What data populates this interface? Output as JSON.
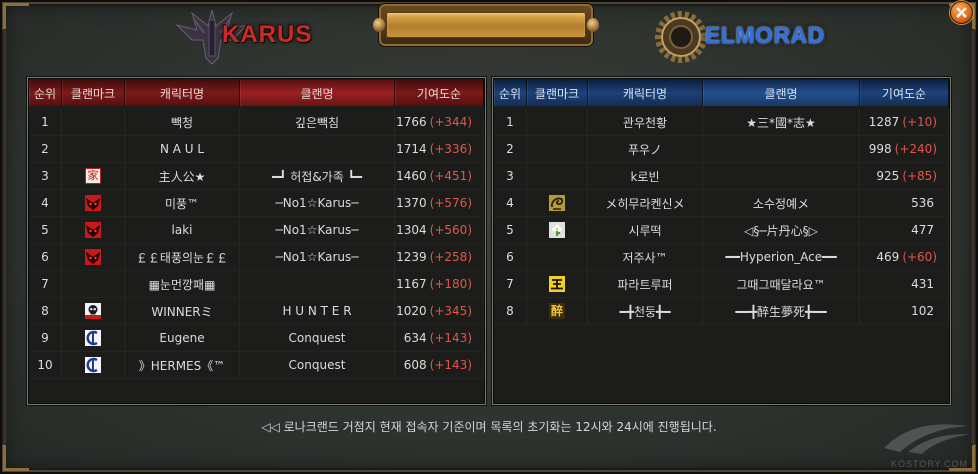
{
  "header": {
    "karus_title": "KARUS",
    "elmorad_title": "ELMORAD"
  },
  "icons": {
    "close": "close-icon",
    "karus_emblem": "karus-emblem-icon",
    "elmorad_emblem": "elmorad-emblem-icon"
  },
  "colors": {
    "karus_header": "#7c1a1a",
    "elmorad_header": "#1d4278",
    "karus_title": "#c62c28",
    "elmorad_title": "#2f70da",
    "delta": "#e0564a",
    "text": "#dcdcdc",
    "banner": "#c8923a",
    "close_button": "#e26c1a"
  },
  "karus": {
    "columns": [
      "순위",
      "클랜마크",
      "캐릭터명",
      "클랜명",
      "기여도순"
    ],
    "rows": [
      {
        "rank": "1",
        "name": "빽청",
        "clan": "깊은빽침",
        "score": "1766",
        "delta": "(+344)"
      },
      {
        "rank": "2",
        "name": "N A U L",
        "clan": "",
        "score": "1714",
        "delta": "(+336)"
      },
      {
        "rank": "3",
        "mark": {
          "icon": "clan-mark-house-icon",
          "glyph": "家"
        },
        "name": "主人公★",
        "clan": "━┛ 허접&가족 ┗━",
        "score": "1460",
        "delta": "(+451)"
      },
      {
        "rank": "4",
        "mark": {
          "icon": "clan-mark-red-mask-icon"
        },
        "name": "미풍™",
        "clan": "─No1☆Karus─",
        "score": "1370",
        "delta": "(+576)"
      },
      {
        "rank": "5",
        "mark": {
          "icon": "clan-mark-red-mask-icon"
        },
        "name": "laki",
        "clan": "─No1☆Karus─",
        "score": "1304",
        "delta": "(+560)"
      },
      {
        "rank": "6",
        "mark": {
          "icon": "clan-mark-red-mask-icon"
        },
        "name": "￡￡태풍의눈￡￡",
        "clan": "─No1☆Karus─",
        "score": "1239",
        "delta": "(+258)"
      },
      {
        "rank": "7",
        "name": "▦눈먼깡패▦",
        "clan": "",
        "score": "1167",
        "delta": "(+180)"
      },
      {
        "rank": "8",
        "mark": {
          "icon": "clan-mark-skull-icon"
        },
        "name": "WINNERミ",
        "clan": "H U N T E R",
        "score": "1020",
        "delta": "(+345)"
      },
      {
        "rank": "9",
        "mark": {
          "icon": "clan-mark-blue-c-icon"
        },
        "name": "Eugene",
        "clan": "Conquest",
        "score": "634",
        "delta": "(+143)"
      },
      {
        "rank": "10",
        "mark": {
          "icon": "clan-mark-blue-c-icon"
        },
        "name": "》HERMES《™",
        "clan": "Conquest",
        "score": "608",
        "delta": "(+143)"
      }
    ]
  },
  "elmorad": {
    "columns": [
      "순위",
      "클랜마크",
      "캐릭터명",
      "클랜명",
      "기여도순"
    ],
    "rows": [
      {
        "rank": "1",
        "name": "관우천황",
        "clan": "★三*國*志★",
        "score": "1287",
        "delta": "(+10)"
      },
      {
        "rank": "2",
        "name": "푸우ノ",
        "clan": "",
        "score": "998",
        "delta": "(+240)"
      },
      {
        "rank": "3",
        "name": "k로빈",
        "clan": "",
        "score": "925",
        "delta": "(+85)"
      },
      {
        "rank": "4",
        "mark": {
          "icon": "clan-mark-gold-dragon-icon"
        },
        "name": "メ히무라켄신メ",
        "clan": "소수정예メ",
        "score": "536"
      },
      {
        "rank": "5",
        "mark": {
          "icon": "clan-mark-flower-icon"
        },
        "name": "시루떡",
        "clan": "◁§─片丹心§▷",
        "score": "477"
      },
      {
        "rank": "6",
        "name": "저주사™",
        "clan": "━━Hyperion_Ace━━",
        "score": "469",
        "delta": "(+60)"
      },
      {
        "rank": "7",
        "mark": {
          "icon": "clan-mark-yellow-icon"
        },
        "name": "파라트루퍼",
        "clan": "그때그때달라요™",
        "score": "431"
      },
      {
        "rank": "8",
        "mark": {
          "icon": "clan-mark-zui-icon",
          "glyph": "醉"
        },
        "name": "━╋천둥╋━",
        "clan": "━━╋醉生夢死╋━━",
        "score": "102"
      }
    ]
  },
  "footer": "◁◁ 로나크랜드 거점지 현재 접속자 기준이며 목록의 초기화는 12시와 24시에 진행됩니다.",
  "watermark": "KOSTORY.COM"
}
